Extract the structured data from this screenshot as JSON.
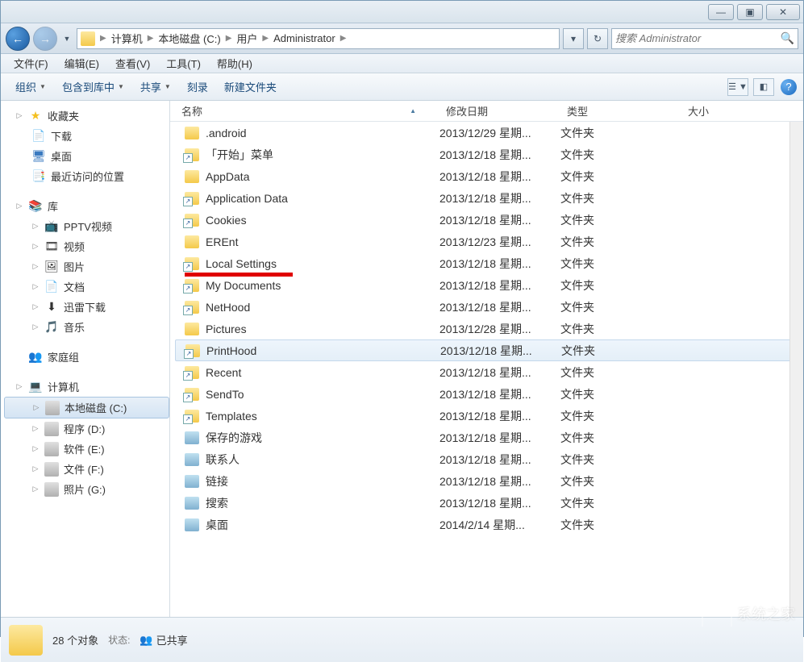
{
  "titlebar": {
    "min": "—",
    "max": "▣",
    "close": "✕"
  },
  "nav": {
    "back": "←",
    "fwd": "→"
  },
  "breadcrumbs": [
    "计算机",
    "本地磁盘 (C:)",
    "用户",
    "Administrator"
  ],
  "address_buttons": {
    "dropdown": "▾",
    "refresh": "↻"
  },
  "search": {
    "placeholder": "搜索 Administrator"
  },
  "menubar": [
    "文件(F)",
    "编辑(E)",
    "查看(V)",
    "工具(T)",
    "帮助(H)"
  ],
  "toolbar": {
    "organize": "组织",
    "include": "包含到库中",
    "share": "共享",
    "burn": "刻录",
    "newfolder": "新建文件夹"
  },
  "sidebar": {
    "favorites": {
      "label": "收藏夹",
      "items": [
        "下载",
        "桌面",
        "最近访问的位置"
      ]
    },
    "libraries": {
      "label": "库",
      "items": [
        "PPTV视频",
        "视频",
        "图片",
        "文档",
        "迅雷下载",
        "音乐"
      ]
    },
    "homegroup": {
      "label": "家庭组"
    },
    "computer": {
      "label": "计算机",
      "items": [
        "本地磁盘 (C:)",
        "程序 (D:)",
        "软件 (E:)",
        "文件 (F:)",
        "照片 (G:)"
      ]
    }
  },
  "columns": {
    "name": "名称",
    "date": "修改日期",
    "type": "类型",
    "size": "大小"
  },
  "files": [
    {
      "name": ".android",
      "date": "2013/12/29 星期...",
      "type": "文件夹",
      "link": false
    },
    {
      "name": "「开始」菜单",
      "date": "2013/12/18 星期...",
      "type": "文件夹",
      "link": true
    },
    {
      "name": "AppData",
      "date": "2013/12/18 星期...",
      "type": "文件夹",
      "link": false
    },
    {
      "name": "Application Data",
      "date": "2013/12/18 星期...",
      "type": "文件夹",
      "link": true
    },
    {
      "name": "Cookies",
      "date": "2013/12/18 星期...",
      "type": "文件夹",
      "link": true
    },
    {
      "name": "EREnt",
      "date": "2013/12/23 星期...",
      "type": "文件夹",
      "link": false
    },
    {
      "name": "Local Settings",
      "date": "2013/12/18 星期...",
      "type": "文件夹",
      "link": true
    },
    {
      "name": "My Documents",
      "date": "2013/12/18 星期...",
      "type": "文件夹",
      "link": true
    },
    {
      "name": "NetHood",
      "date": "2013/12/18 星期...",
      "type": "文件夹",
      "link": true
    },
    {
      "name": "Pictures",
      "date": "2013/12/28 星期...",
      "type": "文件夹",
      "link": false
    },
    {
      "name": "PrintHood",
      "date": "2013/12/18 星期...",
      "type": "文件夹",
      "link": true,
      "hl": true
    },
    {
      "name": "Recent",
      "date": "2013/12/18 星期...",
      "type": "文件夹",
      "link": true
    },
    {
      "name": "SendTo",
      "date": "2013/12/18 星期...",
      "type": "文件夹",
      "link": true
    },
    {
      "name": "Templates",
      "date": "2013/12/18 星期...",
      "type": "文件夹",
      "link": true
    },
    {
      "name": "保存的游戏",
      "date": "2013/12/18 星期...",
      "type": "文件夹",
      "link": false,
      "special": true
    },
    {
      "name": "联系人",
      "date": "2013/12/18 星期...",
      "type": "文件夹",
      "link": false,
      "special": true
    },
    {
      "name": "链接",
      "date": "2013/12/18 星期...",
      "type": "文件夹",
      "link": false,
      "special": true
    },
    {
      "name": "搜索",
      "date": "2013/12/18 星期...",
      "type": "文件夹",
      "link": false,
      "special": true
    },
    {
      "name": "桌面",
      "date": "2014/2/14 星期...",
      "type": "文件夹",
      "link": false,
      "special": true
    }
  ],
  "status": {
    "count": "28 个对象",
    "state_label": "状态:",
    "state_value": "已共享"
  },
  "watermark": "系统之家"
}
